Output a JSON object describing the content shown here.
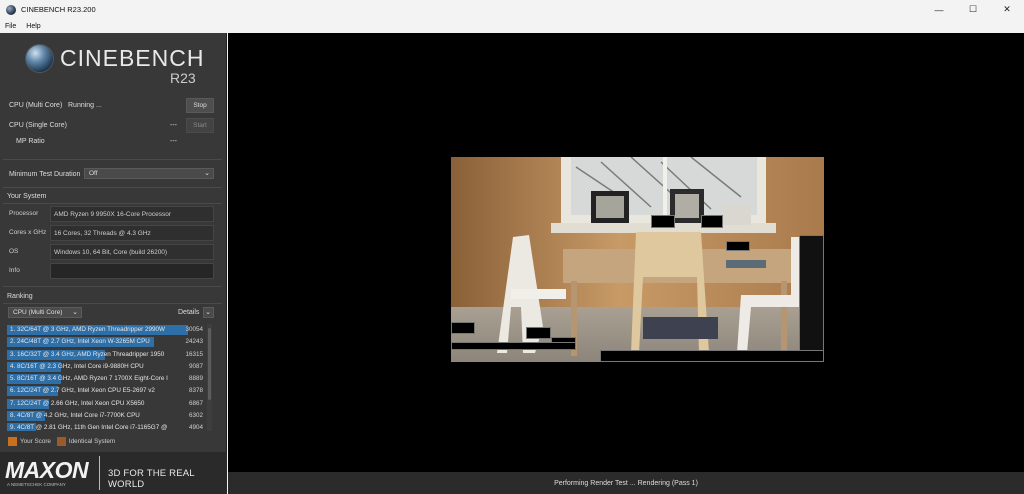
{
  "window": {
    "title": "CINEBENCH R23.200",
    "controls": [
      "—",
      "☐",
      "✕"
    ]
  },
  "menu": [
    "File",
    "Help"
  ],
  "logo": {
    "name": "CINEBENCH",
    "version": "R23"
  },
  "tests": {
    "multi": {
      "label": "CPU (Multi Core)",
      "status": "Running ...",
      "button": "Stop"
    },
    "single": {
      "label": "CPU (Single Core)",
      "status": "---",
      "button": "Start"
    },
    "ratio": {
      "label": "MP Ratio",
      "status": "---"
    }
  },
  "min_duration": {
    "label": "Minimum Test Duration",
    "value": "Off"
  },
  "system": {
    "title": "Your System",
    "processor": {
      "label": "Processor",
      "value": "AMD Ryzen 9 9950X 16-Core Processor"
    },
    "cores": {
      "label": "Cores x GHz",
      "value": "16 Cores, 32 Threads @ 4.3 GHz"
    },
    "os": {
      "label": "OS",
      "value": "Windows 10, 64 Bit, Core (build 26200)"
    },
    "info": {
      "label": "Info",
      "value": ""
    }
  },
  "ranking": {
    "title": "Ranking",
    "dropdown": "CPU (Multi Core)",
    "details": "Details",
    "items": [
      {
        "label": "1. 32C/64T @ 3 GHz, AMD Ryzen Threadripper 2990W",
        "score": "30054",
        "fraction": 1.0
      },
      {
        "label": "2. 24C/48T @ 2.7 GHz, Intel Xeon W-3265M CPU",
        "score": "24243",
        "fraction": 0.81
      },
      {
        "label": "3. 16C/32T @ 3.4 GHz, AMD Ryzen Threadripper 1950",
        "score": "16315",
        "fraction": 0.54
      },
      {
        "label": "4. 8C/16T @ 2.3 GHz, Intel Core i9-9880H CPU",
        "score": "9087",
        "fraction": 0.3
      },
      {
        "label": "5. 8C/16T @ 3.4 GHz, AMD Ryzen 7 1700X Eight-Core I",
        "score": "8889",
        "fraction": 0.3
      },
      {
        "label": "6. 12C/24T @ 2.7 GHz, Intel Xeon CPU E5-2697 v2",
        "score": "8378",
        "fraction": 0.28
      },
      {
        "label": "7. 12C/24T @ 2.66 GHz, Intel Xeon CPU X5650",
        "score": "6867",
        "fraction": 0.23
      },
      {
        "label": "8. 4C/8T @ 4.2 GHz, Intel Core i7-7700K CPU",
        "score": "6302",
        "fraction": 0.21
      },
      {
        "label": "9. 4C/8T @ 2.81 GHz, 11th Gen Intel Core i7-1165G7 @",
        "score": "4904",
        "fraction": 0.16
      }
    ]
  },
  "legend": {
    "your_score": "Your Score",
    "identical": "Identical System",
    "your_color": "#c8701e",
    "identical_color": "#9b5a2a"
  },
  "maxon": {
    "logo": "MAXON",
    "sub": "A NEMETSCHEK COMPANY",
    "tagline": "3D FOR THE REAL WORLD"
  },
  "status_text": "Performing Render Test ... Rendering (Pass 1)",
  "colors": {
    "bar": "#2f6fa8",
    "panel": "#383838"
  }
}
